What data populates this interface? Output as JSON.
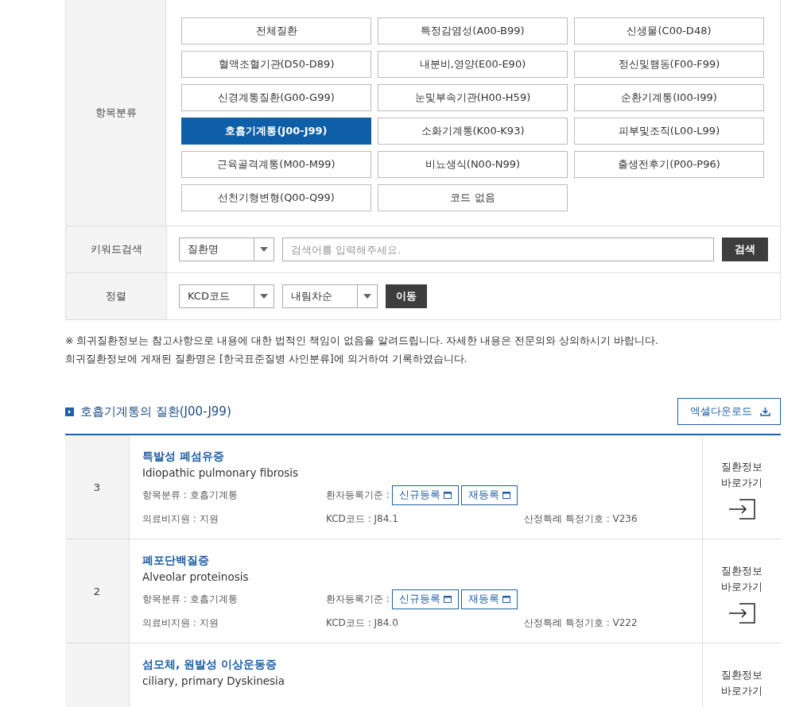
{
  "filters": {
    "category": {
      "label": "항목분류",
      "options": [
        {
          "label": "전체질환",
          "selected": false
        },
        {
          "label": "특정감염성(A00-B99)",
          "selected": false
        },
        {
          "label": "신생물(C00-D48)",
          "selected": false
        },
        {
          "label": "혈액조혈기관(D50-D89)",
          "selected": false
        },
        {
          "label": "내분비,영양(E00-E90)",
          "selected": false
        },
        {
          "label": "정신및행동(F00-F99)",
          "selected": false
        },
        {
          "label": "신경계통질환(G00-G99)",
          "selected": false
        },
        {
          "label": "눈및부속기관(H00-H59)",
          "selected": false
        },
        {
          "label": "순환기계통(I00-I99)",
          "selected": false
        },
        {
          "label": "호흡기계통(J00-J99)",
          "selected": true
        },
        {
          "label": "소화기계통(K00-K93)",
          "selected": false
        },
        {
          "label": "피부및조직(L00-L99)",
          "selected": false
        },
        {
          "label": "근육골격계통(M00-M99)",
          "selected": false
        },
        {
          "label": "비뇨생식(N00-N99)",
          "selected": false
        },
        {
          "label": "출생전후기(P00-P96)",
          "selected": false
        },
        {
          "label": "선천기형변형(Q00-Q99)",
          "selected": false
        },
        {
          "label": "코드 없음",
          "selected": false
        }
      ]
    },
    "keyword": {
      "label": "키워드검색",
      "select": "질환명",
      "placeholder": "검색어를 입력해주세요.",
      "button": "검색"
    },
    "sort": {
      "label": "정렬",
      "selects": [
        "KCD코드",
        "내림차순"
      ],
      "button": "이동"
    }
  },
  "notices": [
    "※ 희귀질환정보는 참고사항으로 내용에 대한 법적인 책임이 없음을 알려드립니다. 자세한 내용은 전문의와 상의하시기 바랍니다.",
    "희귀질환정보에 게재된 질환명은 [한국표준질병 사인분류]에 의거하여 기록하였습니다."
  ],
  "section": {
    "title": "호흡기계통의 질환(J00-J99)",
    "download": "엑셀다운로드"
  },
  "rows": [
    {
      "number": "3",
      "name": "특발성 폐섬유증",
      "name_en": "Idiopathic pulmonary fibrosis",
      "category": "항목분류 : 호흡기계통",
      "registration_label": "환자등록기준 :",
      "registration_buttons": [
        "신규등록",
        "재등록"
      ],
      "support": "의료비지원 : 지원",
      "kcd": "KCD코드 : J84.1",
      "special": "산정특례 특정기호 : V236",
      "link": "질환정보 바로가기"
    },
    {
      "number": "2",
      "name": "폐포단백질증",
      "name_en": "Alveolar proteinosis",
      "category": "항목분류 : 호흡기계통",
      "registration_label": "환자등록기준 :",
      "registration_buttons": [
        "신규등록",
        "재등록"
      ],
      "support": "의료비지원 : 지원",
      "kcd": "KCD코드 : J84.0",
      "special": "산정특례 특정기호 : V222",
      "link": "질환정보 바로가기"
    },
    {
      "name": "섬모체, 원발성 이상운동증",
      "name_en": "ciliary, primary Dyskinesia",
      "link": "질환정보 바로가기"
    }
  ]
}
